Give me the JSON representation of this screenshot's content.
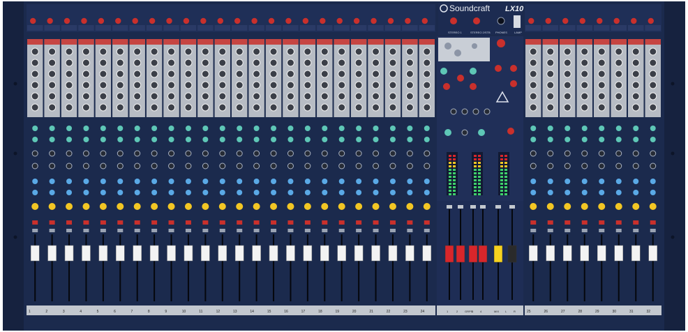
{
  "brand": {
    "name": "Soundcraft",
    "model": "LX10"
  },
  "sections": {
    "left_channels": {
      "count": 24,
      "numbers": [
        "1",
        "2",
        "3",
        "4",
        "5",
        "6",
        "7",
        "8",
        "9",
        "10",
        "11",
        "12",
        "13",
        "14",
        "15",
        "16",
        "17",
        "18",
        "19",
        "20",
        "21",
        "22",
        "23",
        "24"
      ]
    },
    "right_channels": {
      "count": 8,
      "numbers": [
        "25",
        "26",
        "27",
        "28",
        "29",
        "30",
        "31",
        "32"
      ]
    },
    "master": {
      "top_labels": [
        "STEREO 1",
        "STEREO 2/STB",
        "PHONES",
        "LAMP"
      ],
      "bottom_labels": [
        "1",
        "2",
        "GRPS",
        "3",
        "4",
        "MIX",
        "L",
        "R"
      ]
    }
  },
  "colors": {
    "panel": "#1e2e55",
    "strip_gray": "#b7bcc4",
    "knob_red": "#c9302c",
    "knob_teal": "#5ec7b6",
    "knob_blue": "#5aa9e6",
    "knob_yellow": "#f2c624",
    "fader_white": "#f3f3f3",
    "fader_red": "#d8262b",
    "fader_yellow": "#f6d21f"
  }
}
